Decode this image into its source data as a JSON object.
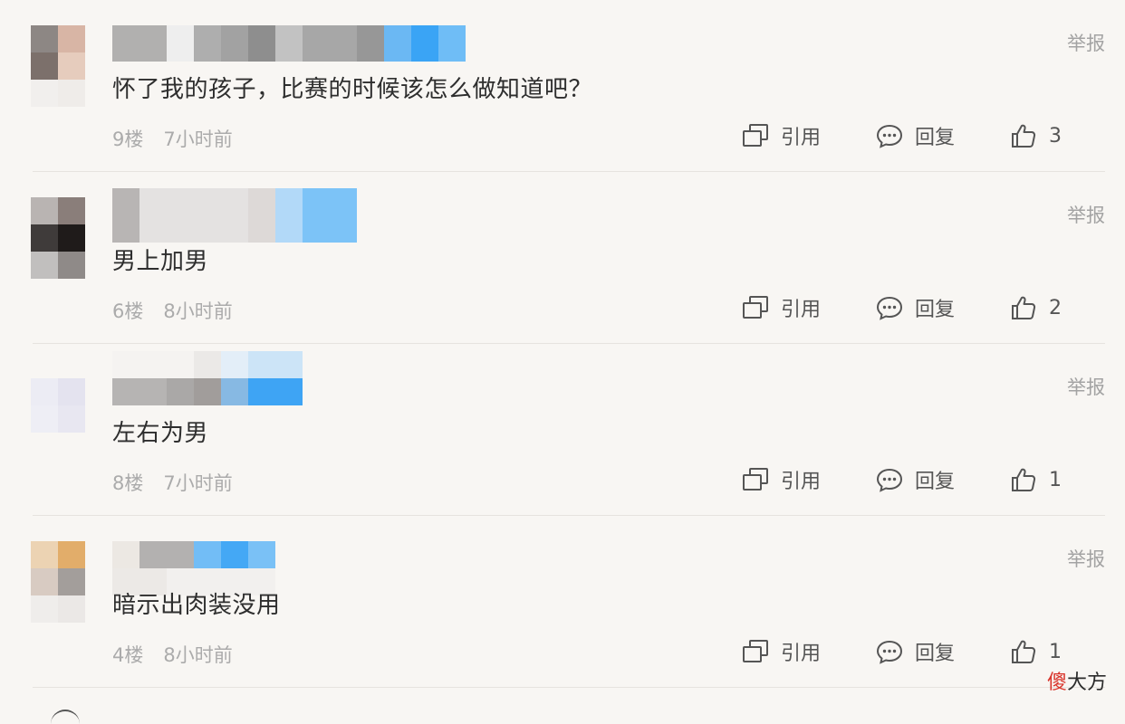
{
  "comments": [
    {
      "text": "怀了我的孩子，比赛的时候该怎么做知道吧？",
      "floor": "9楼",
      "time": "7小时前",
      "report": "举报",
      "quote": "引用",
      "reply": "回复",
      "likes": "3"
    },
    {
      "text": "男上加男",
      "floor": "6楼",
      "time": "8小时前",
      "report": "举报",
      "quote": "引用",
      "reply": "回复",
      "likes": "2"
    },
    {
      "text": "左右为男",
      "floor": "8楼",
      "time": "7小时前",
      "report": "举报",
      "quote": "引用",
      "reply": "回复",
      "likes": "1"
    },
    {
      "text": "暗示出肉装没用",
      "floor": "4楼",
      "time": "8小时前",
      "report": "举报",
      "quote": "引用",
      "reply": "回复",
      "likes": "1"
    }
  ],
  "watermark": {
    "part1": "傻",
    "part2": "大方"
  },
  "colors": {
    "link_blue": "#5aaef5",
    "meta_gray": "#ababab",
    "text": "#2e2e2e"
  },
  "icons": [
    "quote-icon",
    "reply-bubble-icon",
    "thumbs-up-icon"
  ]
}
